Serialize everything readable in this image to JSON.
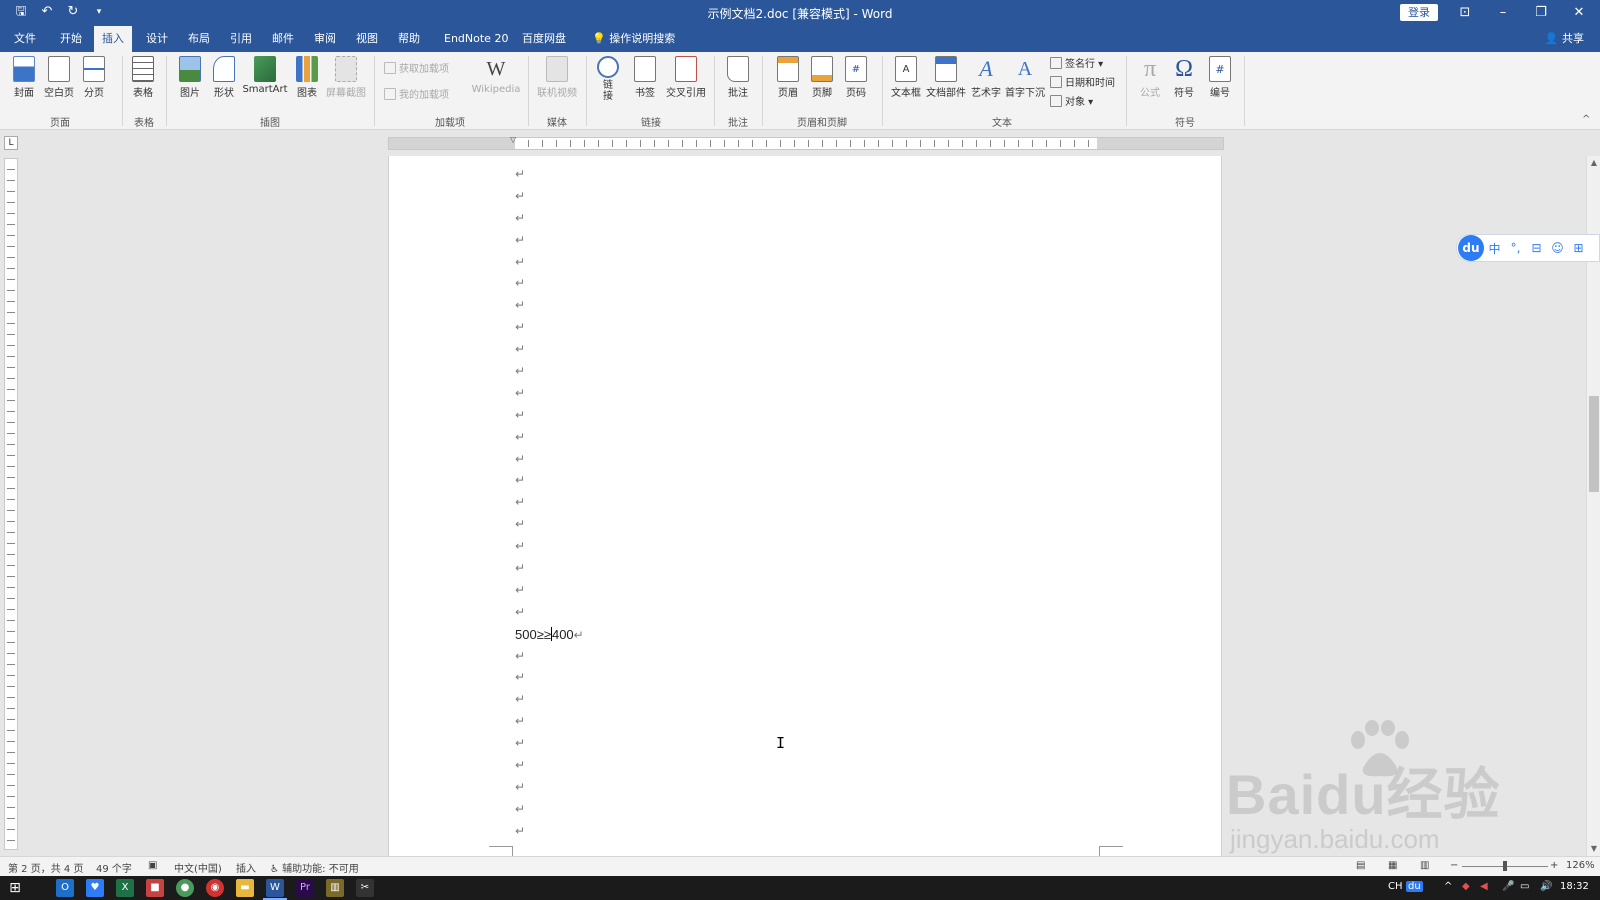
{
  "window": {
    "title": "示例文档2.doc [兼容模式] - Word",
    "login_label": "登录",
    "qat_icons": [
      "save-icon",
      "undo-icon",
      "redo-icon",
      "customize-icon"
    ]
  },
  "tabs": [
    {
      "label": "文件"
    },
    {
      "label": "开始"
    },
    {
      "label": "插入",
      "active": true
    },
    {
      "label": "设计"
    },
    {
      "label": "布局"
    },
    {
      "label": "引用"
    },
    {
      "label": "邮件"
    },
    {
      "label": "审阅"
    },
    {
      "label": "视图"
    },
    {
      "label": "帮助"
    },
    {
      "label": "EndNote 20"
    },
    {
      "label": "百度网盘"
    },
    {
      "label": "操作说明搜索"
    }
  ],
  "share_label": "共享",
  "ribbon": {
    "groups": {
      "page": "页面",
      "table": "表格",
      "illustrations": "插图",
      "addins": "加载项",
      "media": "媒体",
      "links": "链接",
      "comments": "批注",
      "header_footer": "页眉和页脚",
      "text": "文本",
      "symbols": "符号"
    },
    "buttons": {
      "cover": "封面",
      "blank_page": "空白页",
      "page_break": "分页",
      "table": "表格",
      "pictures": "图片",
      "shapes": "形状",
      "smartart": "SmartArt",
      "chart": "图表",
      "screenshot": "屏幕截图",
      "get_addins": "获取加载项",
      "my_addins": "我的加载项",
      "wikipedia": "Wikipedia",
      "online_video": "联机视频",
      "link": "链接",
      "bookmark": "书签",
      "cross_ref": "交叉引用",
      "comment": "批注",
      "header": "页眉",
      "footer": "页脚",
      "page_number": "页码",
      "text_box": "文本框",
      "quick_parts": "文档部件",
      "wordart": "艺术字",
      "drop_cap": "首字下沉",
      "signature_line": "签名行",
      "date_time": "日期和时间",
      "object": "对象",
      "equation": "公式",
      "symbol": "符号",
      "number": "编号"
    },
    "accent": "#2b579a"
  },
  "document": {
    "empty_paragraphs_before": 21,
    "content_line": {
      "before_caret": "500≥≥",
      "after_caret": "400"
    },
    "empty_paragraphs_after": 9,
    "paragraph_mark": "↵"
  },
  "ime": {
    "logo": "du",
    "items": [
      "中",
      "°,",
      "⊟",
      "☺",
      "⊞"
    ]
  },
  "watermark": {
    "brand": "Baidu经验",
    "url": "jingyan.baidu.com"
  },
  "statusbar": {
    "page_info": "第 2 页，共 4 页",
    "word_count": "49 个字",
    "language": "中文(中国)",
    "mode": "插入",
    "accessibility": "辅助功能: 不可用",
    "zoom": "126%",
    "zoom_minus": "−",
    "zoom_plus": "+"
  },
  "taskbar": {
    "clock": "18:32",
    "ime_indicator": "CH",
    "ime_du": "du"
  }
}
